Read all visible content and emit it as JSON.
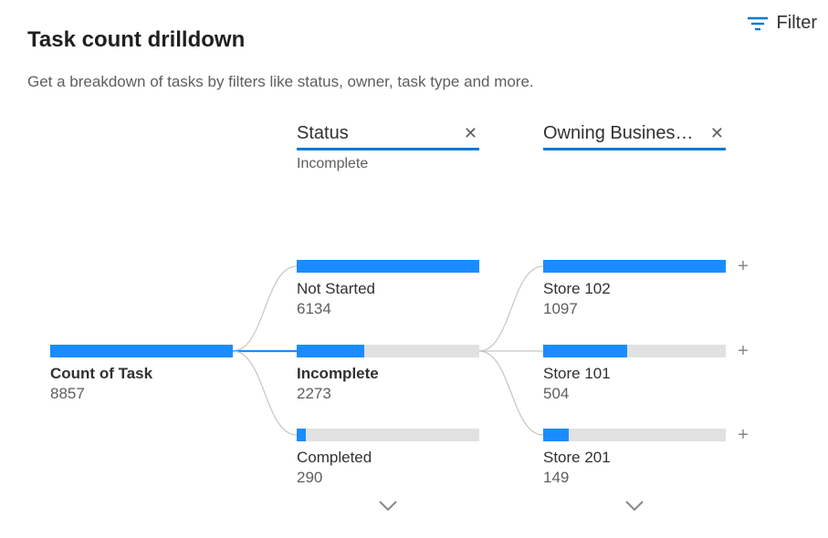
{
  "header": {
    "title": "Task count drilldown",
    "subtitle": "Get a breakdown of tasks by filters like status, owner, task type and more.",
    "filter_label": "Filter"
  },
  "columns": {
    "root": {
      "label": "Count of Task",
      "value": "8857"
    },
    "status": {
      "header": "Status",
      "selected": "Incomplete",
      "items": [
        {
          "label": "Not Started",
          "value": "6134"
        },
        {
          "label": "Incomplete",
          "value": "2273"
        },
        {
          "label": "Completed",
          "value": "290"
        }
      ]
    },
    "business": {
      "header": "Owning Business...",
      "items": [
        {
          "label": "Store 102",
          "value": "1097"
        },
        {
          "label": "Store 101",
          "value": "504"
        },
        {
          "label": "Store 201",
          "value": "149"
        }
      ]
    }
  },
  "chart_data": {
    "type": "bar",
    "title": "Task count drilldown",
    "root": {
      "label": "Count of Task",
      "value": 8857
    },
    "levels": [
      {
        "name": "Status",
        "selected": "Incomplete",
        "items": [
          {
            "label": "Not Started",
            "value": 6134
          },
          {
            "label": "Incomplete",
            "value": 2273
          },
          {
            "label": "Completed",
            "value": 290
          }
        ]
      },
      {
        "name": "Owning Business Unit",
        "items": [
          {
            "label": "Store 102",
            "value": 1097
          },
          {
            "label": "Store 101",
            "value": 504
          },
          {
            "label": "Store 201",
            "value": 149
          }
        ]
      }
    ]
  },
  "colors": {
    "accent": "#1a8cff",
    "bar_bg": "#e1e1e1",
    "muted": "#605e5c"
  }
}
